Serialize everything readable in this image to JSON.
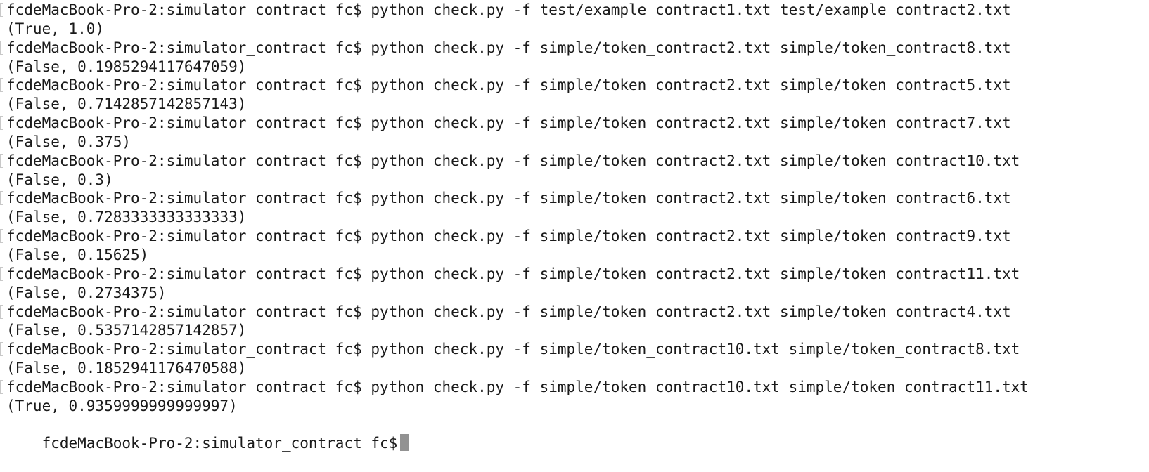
{
  "terminal": {
    "lines": [
      {
        "text": "fcdeMacBook-Pro-2:simulator_contract fc$ python check.py -f test/example_contract1.txt test/example_contract2.txt",
        "kind": "command",
        "marked": true
      },
      {
        "text": "(True, 1.0)",
        "kind": "output"
      },
      {
        "text": "fcdeMacBook-Pro-2:simulator_contract fc$ python check.py -f simple/token_contract2.txt simple/token_contract8.txt",
        "kind": "command",
        "marked": true
      },
      {
        "text": "(False, 0.1985294117647059)",
        "kind": "output"
      },
      {
        "text": "fcdeMacBook-Pro-2:simulator_contract fc$ python check.py -f simple/token_contract2.txt simple/token_contract5.txt",
        "kind": "command",
        "marked": true
      },
      {
        "text": "(False, 0.7142857142857143)",
        "kind": "output"
      },
      {
        "text": "fcdeMacBook-Pro-2:simulator_contract fc$ python check.py -f simple/token_contract2.txt simple/token_contract7.txt",
        "kind": "command",
        "marked": true
      },
      {
        "text": "(False, 0.375)",
        "kind": "output"
      },
      {
        "text": "fcdeMacBook-Pro-2:simulator_contract fc$ python check.py -f simple/token_contract2.txt simple/token_contract10.txt",
        "kind": "command",
        "marked": true
      },
      {
        "text": "(False, 0.3)",
        "kind": "output"
      },
      {
        "text": "fcdeMacBook-Pro-2:simulator_contract fc$ python check.py -f simple/token_contract2.txt simple/token_contract6.txt",
        "kind": "command",
        "marked": true
      },
      {
        "text": "(False, 0.7283333333333333)",
        "kind": "output"
      },
      {
        "text": "fcdeMacBook-Pro-2:simulator_contract fc$ python check.py -f simple/token_contract2.txt simple/token_contract9.txt",
        "kind": "command",
        "marked": true
      },
      {
        "text": "(False, 0.15625)",
        "kind": "output"
      },
      {
        "text": "fcdeMacBook-Pro-2:simulator_contract fc$ python check.py -f simple/token_contract2.txt simple/token_contract11.txt",
        "kind": "command",
        "marked": true
      },
      {
        "text": "(False, 0.2734375)",
        "kind": "output"
      },
      {
        "text": "fcdeMacBook-Pro-2:simulator_contract fc$ python check.py -f simple/token_contract2.txt simple/token_contract4.txt",
        "kind": "command",
        "marked": true
      },
      {
        "text": "(False, 0.5357142857142857)",
        "kind": "output"
      },
      {
        "text": "fcdeMacBook-Pro-2:simulator_contract fc$ python check.py -f simple/token_contract10.txt simple/token_contract8.txt",
        "kind": "command",
        "marked": true
      },
      {
        "text": "(False, 0.1852941176470588)",
        "kind": "output"
      },
      {
        "text": "fcdeMacBook-Pro-2:simulator_contract fc$ python check.py -f simple/token_contract10.txt simple/token_contract11.txt",
        "kind": "command",
        "marked": true
      },
      {
        "text": "(True, 0.9359999999999997)",
        "kind": "output"
      }
    ],
    "prompt": "fcdeMacBook-Pro-2:simulator_contract fc$",
    "colors": {
      "background": "#ffffff",
      "text": "#1a1a1a",
      "cursor": "#929292"
    }
  }
}
